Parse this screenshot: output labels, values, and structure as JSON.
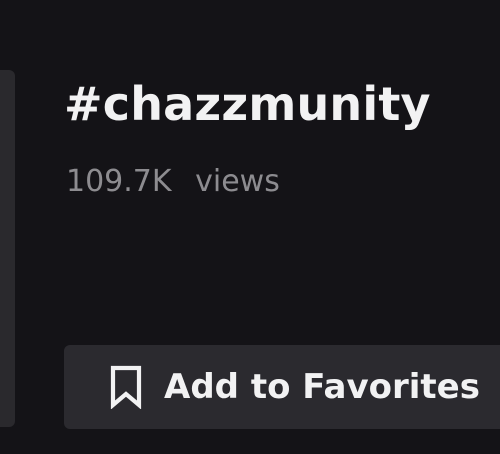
{
  "hashtag": {
    "title": "#chazzmunity",
    "views_count": "109.7K",
    "views_label": "views"
  },
  "actions": {
    "add_favorites_label": "Add to Favorites",
    "add_favorites_icon": "bookmark-icon"
  },
  "colors": {
    "background": "#141317",
    "button_background": "#2b2a2f",
    "primary_text": "#f2f2f3",
    "secondary_text": "#8d8c90"
  }
}
